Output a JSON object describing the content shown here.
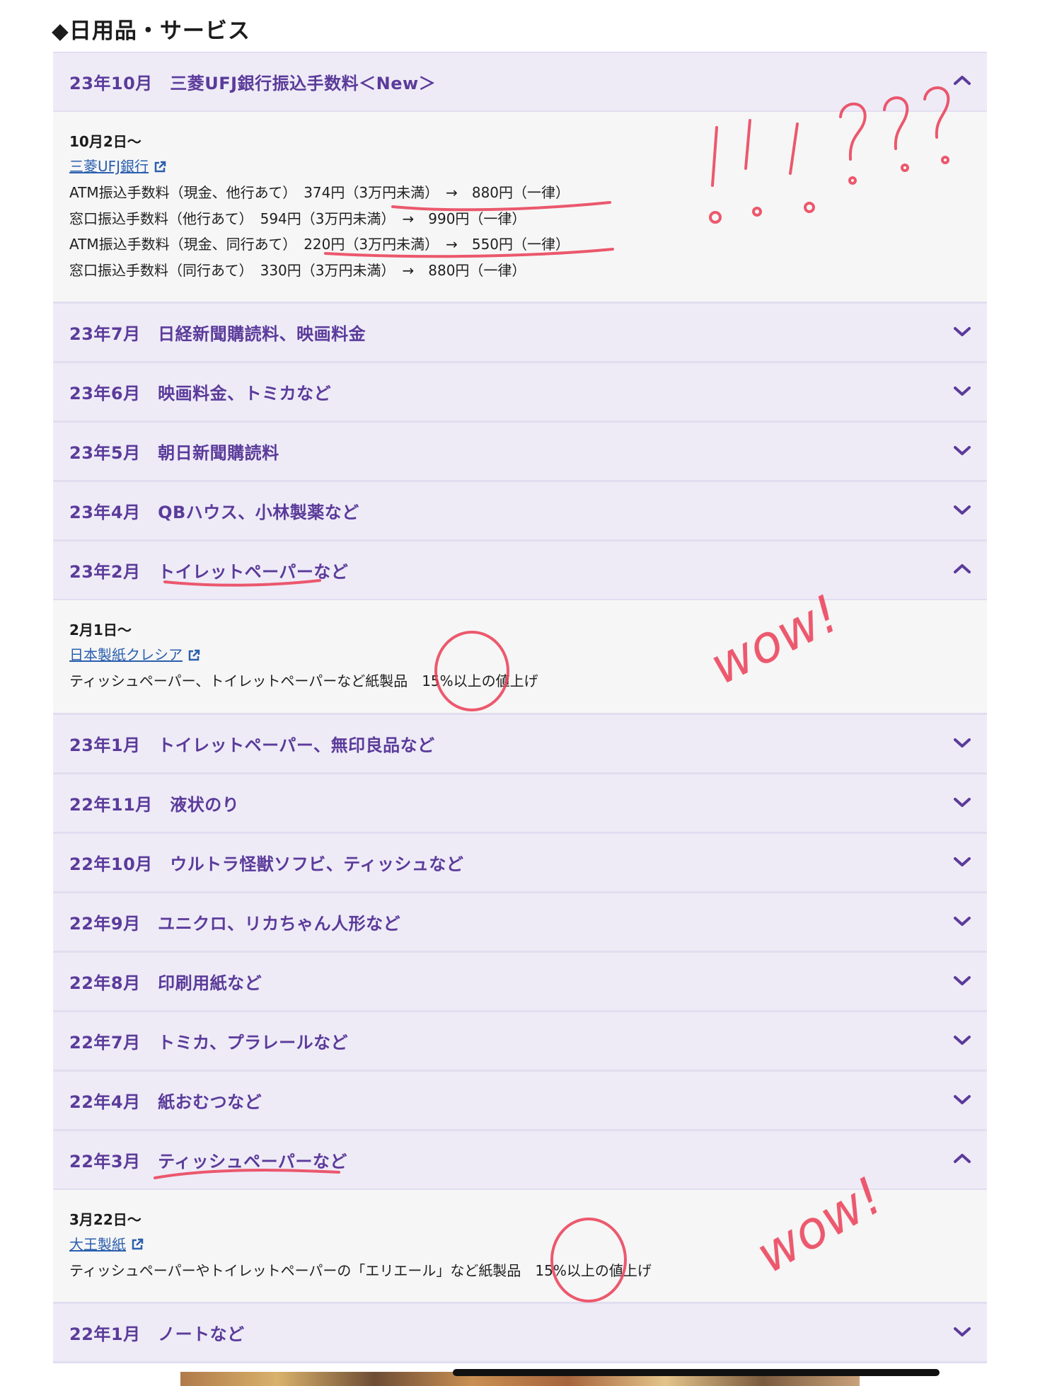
{
  "heading": "◆日用品・サービス",
  "items": [
    {
      "title": "23年10月　三菱UFJ銀行振込手数料＜New＞",
      "expanded": true,
      "date": "10月2日〜",
      "link": "三菱UFJ銀行",
      "lines": [
        "ATM振込手数料（現金、他行あて）　374円（3万円未満）　→　880円（一律）",
        "窓口振込手数料（他行あて）　594円（3万円未満）　→　990円（一律）",
        "ATM振込手数料（現金、同行あて）　220円（3万円未満）　→　550円（一律）",
        "窓口振込手数料（同行あて）　330円（3万円未満）　→　880円（一律）"
      ]
    },
    {
      "title": "23年7月　日経新聞購読料、映画料金",
      "expanded": false
    },
    {
      "title": "23年6月　映画料金、トミカなど",
      "expanded": false
    },
    {
      "title": "23年5月　朝日新聞購読料",
      "expanded": false
    },
    {
      "title": "23年4月　QBハウス、小林製薬など",
      "expanded": false
    },
    {
      "title": "23年2月　トイレットペーパーなど",
      "expanded": true,
      "date": "2月1日〜",
      "link": "日本製紙クレシア",
      "lines": [
        "ティッシュペーパー、トイレットペーパーなど紙製品　15%以上の値上げ"
      ]
    },
    {
      "title": "23年1月　トイレットペーパー、無印良品など",
      "expanded": false
    },
    {
      "title": "22年11月　液状のり",
      "expanded": false
    },
    {
      "title": "22年10月　ウルトラ怪獣ソフビ、ティッシュなど",
      "expanded": false
    },
    {
      "title": "22年9月　ユニクロ、リカちゃん人形など",
      "expanded": false
    },
    {
      "title": "22年8月　印刷用紙など",
      "expanded": false
    },
    {
      "title": "22年7月　トミカ、プラレールなど",
      "expanded": false
    },
    {
      "title": "22年4月　紙おむつなど",
      "expanded": false
    },
    {
      "title": "22年3月　ティッシュペーパーなど",
      "expanded": true,
      "date": "3月22日〜",
      "link": "大王製紙",
      "lines": [
        "ティッシュペーパーやトイレットペーパーの「エリエール」など紙製品　15%以上の値上げ"
      ]
    },
    {
      "title": "22年1月　ノートなど",
      "expanded": false
    }
  ],
  "annotations": {
    "exclaim": "!!!???",
    "wow1": "wow!",
    "wow2": "wow!"
  },
  "colors": {
    "accent": "#5b3b9a",
    "header_bg": "#eeebf7",
    "link": "#2b5fae",
    "annotation": "#e8384f"
  }
}
